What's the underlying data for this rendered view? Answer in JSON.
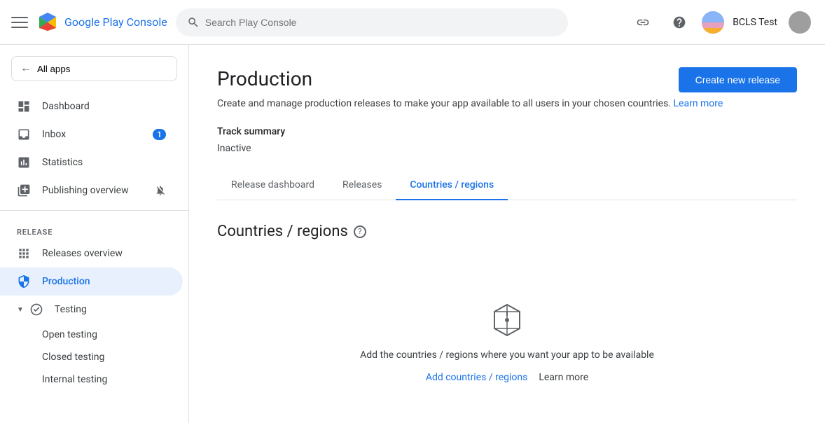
{
  "topbar": {
    "search_placeholder": "Search Play Console",
    "logo_text_main": "Google Play",
    "logo_text_accent": "Console",
    "username": "BCLS Test"
  },
  "sidebar": {
    "all_apps_label": "All apps",
    "nav": [
      {
        "id": "dashboard",
        "label": "Dashboard",
        "icon": "dashboard"
      },
      {
        "id": "inbox",
        "label": "Inbox",
        "icon": "inbox",
        "badge": "1"
      },
      {
        "id": "statistics",
        "label": "Statistics",
        "icon": "statistics"
      },
      {
        "id": "publishing-overview",
        "label": "Publishing overview",
        "icon": "publishing",
        "notification_off": true
      }
    ],
    "release_section_label": "Release",
    "release_nav": [
      {
        "id": "releases-overview",
        "label": "Releases overview",
        "icon": "releases-overview"
      },
      {
        "id": "production",
        "label": "Production",
        "icon": "production",
        "active": true
      },
      {
        "id": "testing",
        "label": "Testing",
        "icon": "testing",
        "expandable": true
      }
    ],
    "testing_sub": [
      {
        "id": "open-testing",
        "label": "Open testing"
      },
      {
        "id": "closed-testing",
        "label": "Closed testing"
      },
      {
        "id": "internal-testing",
        "label": "Internal testing"
      }
    ]
  },
  "main": {
    "page_title": "Production",
    "page_desc": "Create and manage production releases to make your app available to all users in your chosen countries.",
    "learn_more": "Learn more",
    "create_btn_label": "Create new release",
    "track_summary_label": "Track summary",
    "track_status": "Inactive",
    "tabs": [
      {
        "id": "release-dashboard",
        "label": "Release dashboard"
      },
      {
        "id": "releases",
        "label": "Releases"
      },
      {
        "id": "countries-regions",
        "label": "Countries / regions",
        "active": true
      }
    ],
    "section_title": "Countries / regions",
    "empty_text": "Add the countries / regions where you want your app to be available",
    "add_link": "Add countries / regions",
    "learn_more_link": "Learn more"
  }
}
